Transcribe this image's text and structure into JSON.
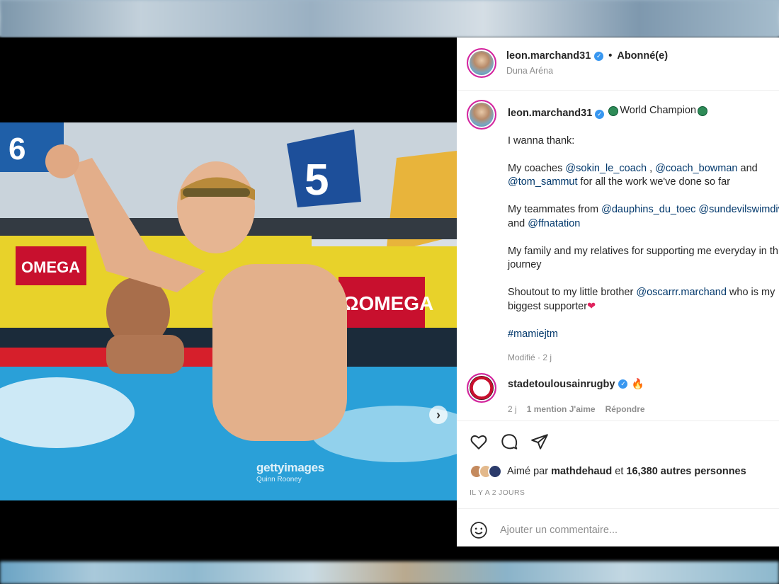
{
  "post": {
    "username": "leon.marchand31",
    "follow_status": "Abonné(e)",
    "location": "Duna Aréna"
  },
  "photo": {
    "watermark_main": "gettyimages",
    "watermark_sub": "Quinn Rooney",
    "lane_number_left": "6",
    "lane_number_right": "5",
    "sponsor_1": "OMEGA",
    "sponsor_2": "ΩOMEGA"
  },
  "caption": {
    "username": "leon.marchand31",
    "headline": "World Champion",
    "line_1": "I wanna thank:",
    "para_2_a": "My coaches ",
    "mention_coach_1": "@sokin_le_coach",
    "para_2_b": " , ",
    "mention_coach_2": "@coach_bowman",
    "para_2_c": " and",
    "mention_coach_3": "@tom_sammut",
    "para_2_d": " for all the work we've done so far",
    "para_3_a": "My teammates from ",
    "mention_team_1": "@dauphins_du_toec",
    "mention_team_2": "@sundevilswimdive",
    "para_3_b": "and ",
    "mention_team_3": "@ffnatation",
    "para_4_l1": "My family and my relatives for supporting me everyday in this",
    "para_4_l2": "journey",
    "para_5_a": "Shoutout to my little brother ",
    "mention_brother": "@oscarrr.marchand",
    "para_5_b": " who is my",
    "para_5_l2": "biggest supporter",
    "heart": "❤",
    "hashtag": "#mamiejtm",
    "edited": "Modifié · 2 j"
  },
  "comment": {
    "username": "stadetoulousainrugby",
    "emoji": "🔥",
    "age": "2 j",
    "likes": "1 mention J'aime",
    "reply": "Répondre"
  },
  "engagement": {
    "liked_by_prefix": "Aimé par ",
    "liked_by_user": "mathdehaud",
    "liked_by_mid": " et ",
    "liked_by_count": "16,380 autres personnes",
    "timestamp": "IL Y A 2 JOURS"
  },
  "composer": {
    "placeholder": "Ajouter un commentaire..."
  },
  "icons": {
    "verified": "verified-badge-icon",
    "like": "heart-icon",
    "comment": "comment-bubble-icon",
    "share": "paper-plane-icon",
    "emoji": "smiley-icon",
    "next": "chevron-right-icon"
  },
  "colors": {
    "link": "#00376b",
    "verified": "#3897f0",
    "muted": "#8e8e8e",
    "story_ring": "#d6249f"
  }
}
